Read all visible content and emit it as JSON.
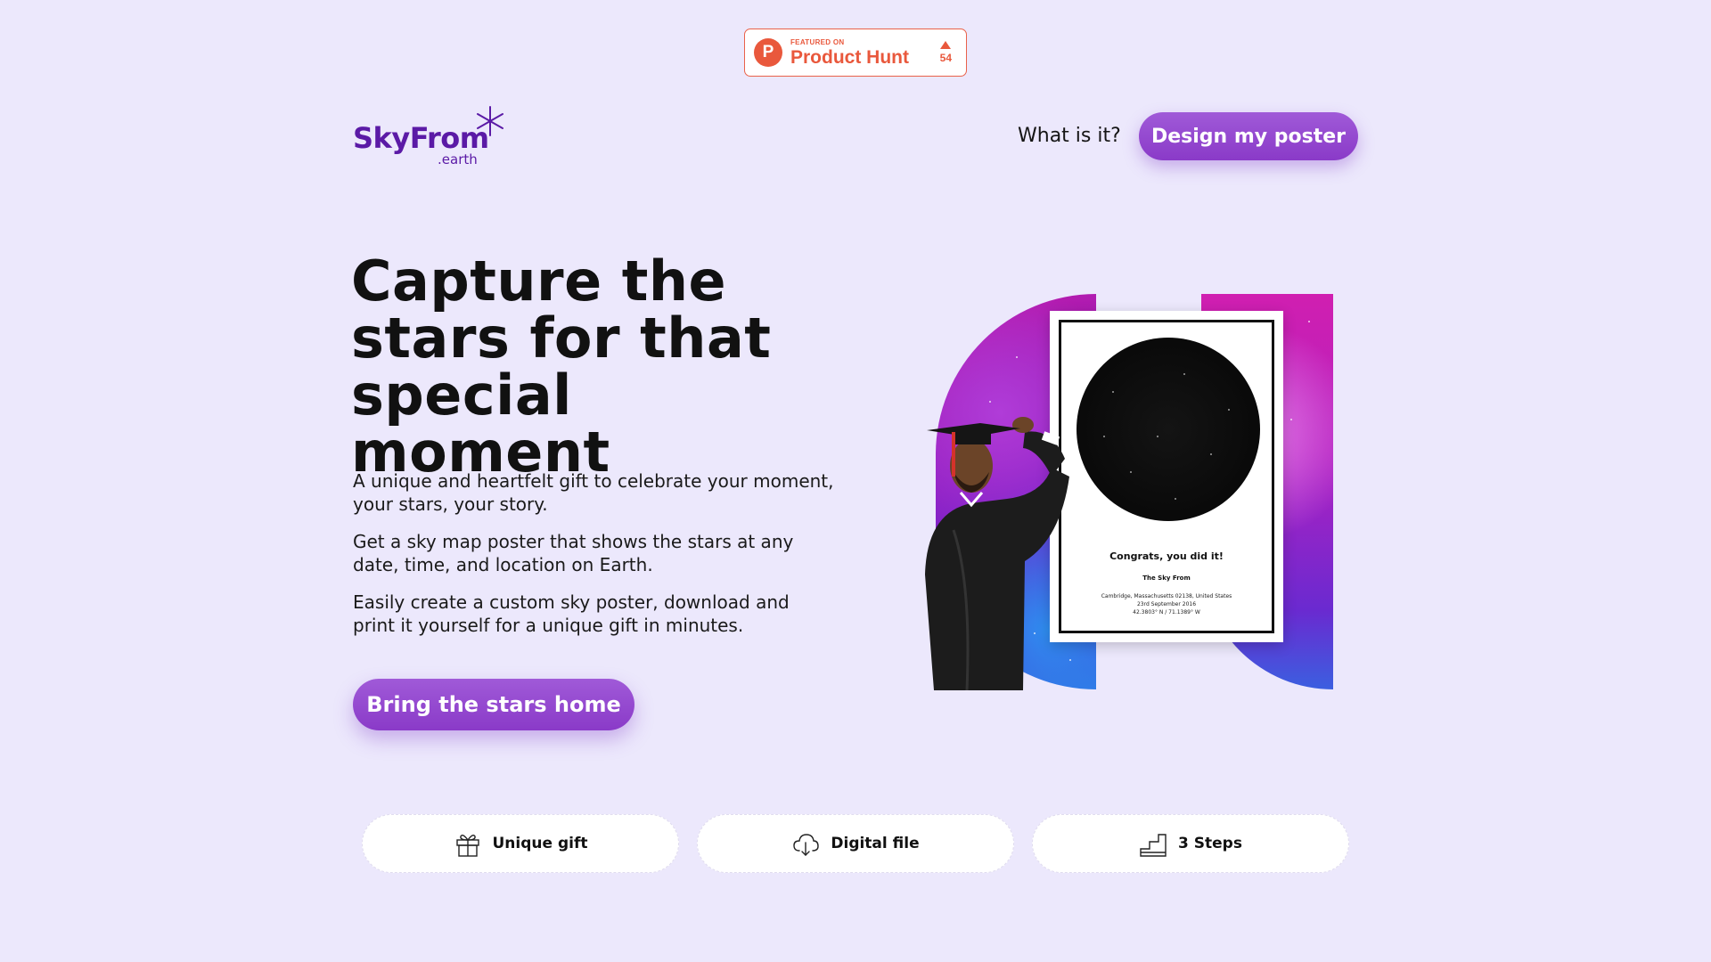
{
  "badge": {
    "featured": "FEATURED ON",
    "name": "Product Hunt",
    "logo_letter": "P",
    "votes": "54",
    "color": "#e9583c"
  },
  "header": {
    "logo_main": "SkyFrom",
    "logo_sub": ".earth",
    "nav_what": "What is it?",
    "cta": "Design my poster"
  },
  "hero": {
    "title_line1": "Capture the",
    "title_line2": "stars for that",
    "title_line3": "special moment",
    "para1": "A unique and heartfelt gift to celebrate your moment, your stars, your story.",
    "para2": "Get a sky map poster that shows the stars at any date, time, and location on Earth.",
    "para3": "Easily create a custom sky poster, download and print it yourself for a unique gift in minutes.",
    "cta": "Bring the stars home"
  },
  "poster": {
    "message": "Congrats, you did it!",
    "title": "The Sky From",
    "location": "Cambridge, Massachusetts 02138, United States",
    "date": "23rd September 2016",
    "coords": "42.3803° N / 71.1389° W"
  },
  "features": [
    {
      "label": "Unique gift",
      "icon": "gift-icon"
    },
    {
      "label": "Digital file",
      "icon": "cloud-download-icon"
    },
    {
      "label": "3 Steps",
      "icon": "steps-icon"
    }
  ],
  "colors": {
    "background": "#ece8fc",
    "brand": "#5b1aa6",
    "button": "#9a4cd4"
  }
}
